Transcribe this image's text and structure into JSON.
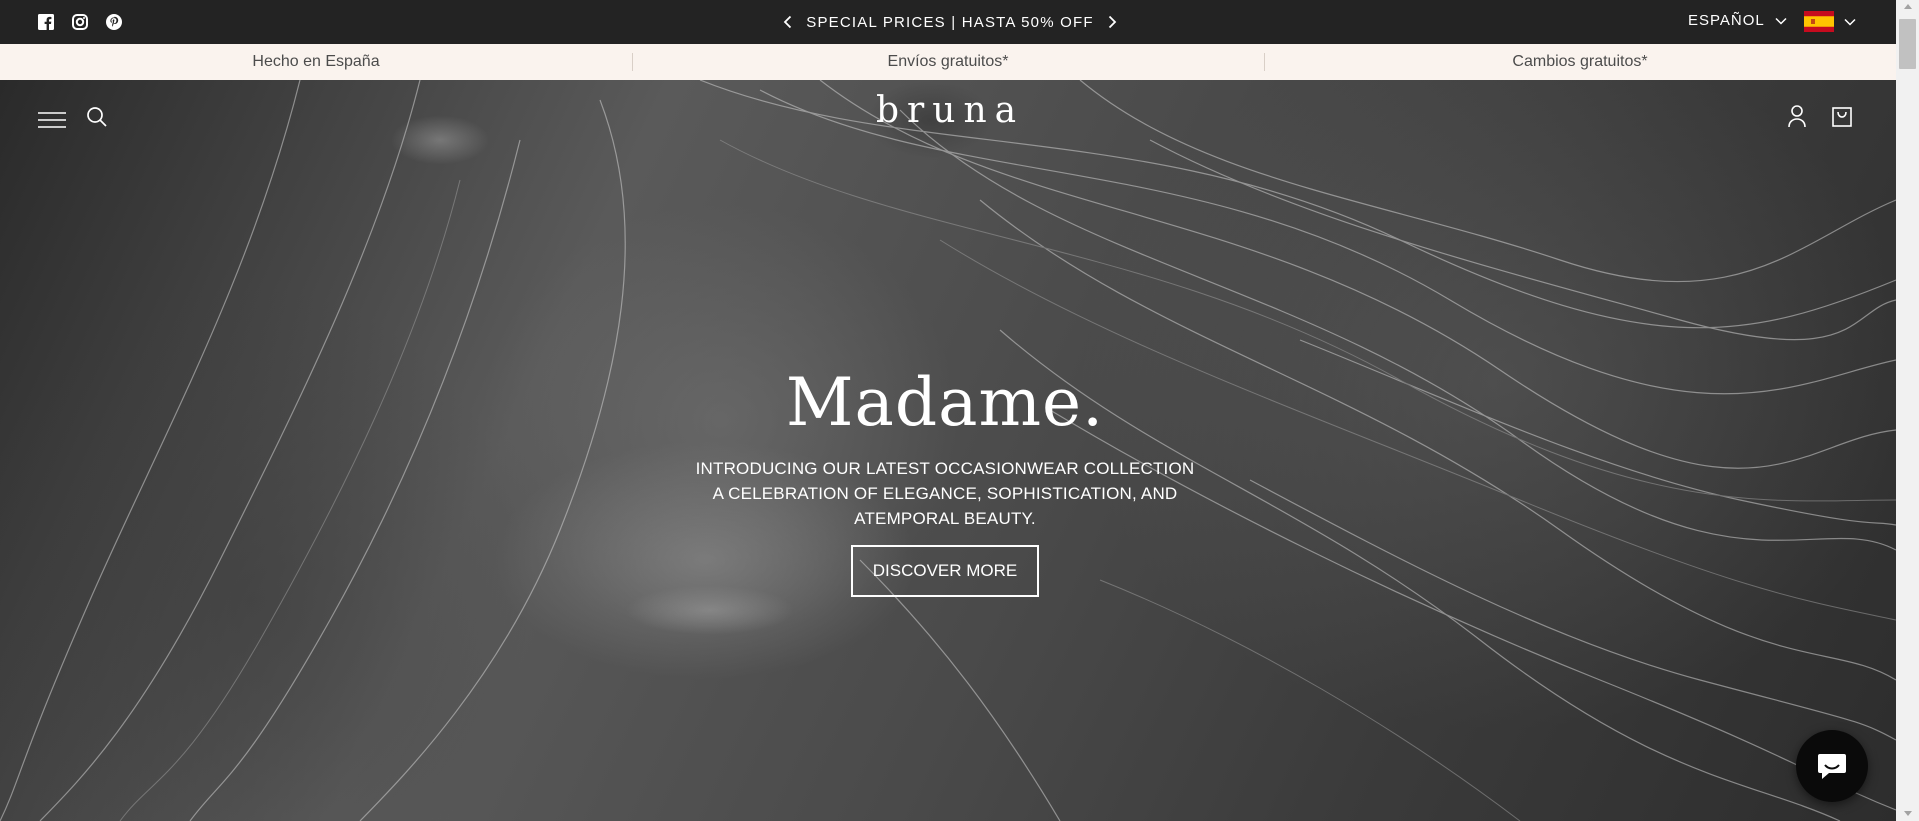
{
  "announcement": {
    "social": [
      {
        "name": "facebook-icon"
      },
      {
        "name": "instagram-icon"
      },
      {
        "name": "pinterest-icon"
      }
    ],
    "promo_text": "SPECIAL PRICES | HASTA 50% OFF",
    "language": "ESPAÑOL",
    "country_flag": "spain-flag-icon"
  },
  "usp_bar": {
    "items": [
      "Hecho en España",
      "Envíos gratuitos*",
      "Cambios gratuitos*"
    ]
  },
  "header": {
    "logo": "bruna"
  },
  "hero": {
    "title": "Madame.",
    "subtitle_lines": [
      "INTRODUCING OUR LATEST OCCASIONWEAR COLLECTION",
      "A CELEBRATION OF ELEGANCE, SOPHISTICATION, AND",
      "ATEMPORAL BEAUTY."
    ],
    "cta_label": "DISCOVER MORE"
  },
  "colors": {
    "announcement_bg": "#232323",
    "usp_bg": "#faf3ee",
    "hero_text": "#ffffff",
    "chat_button": "#0a0a0a"
  }
}
